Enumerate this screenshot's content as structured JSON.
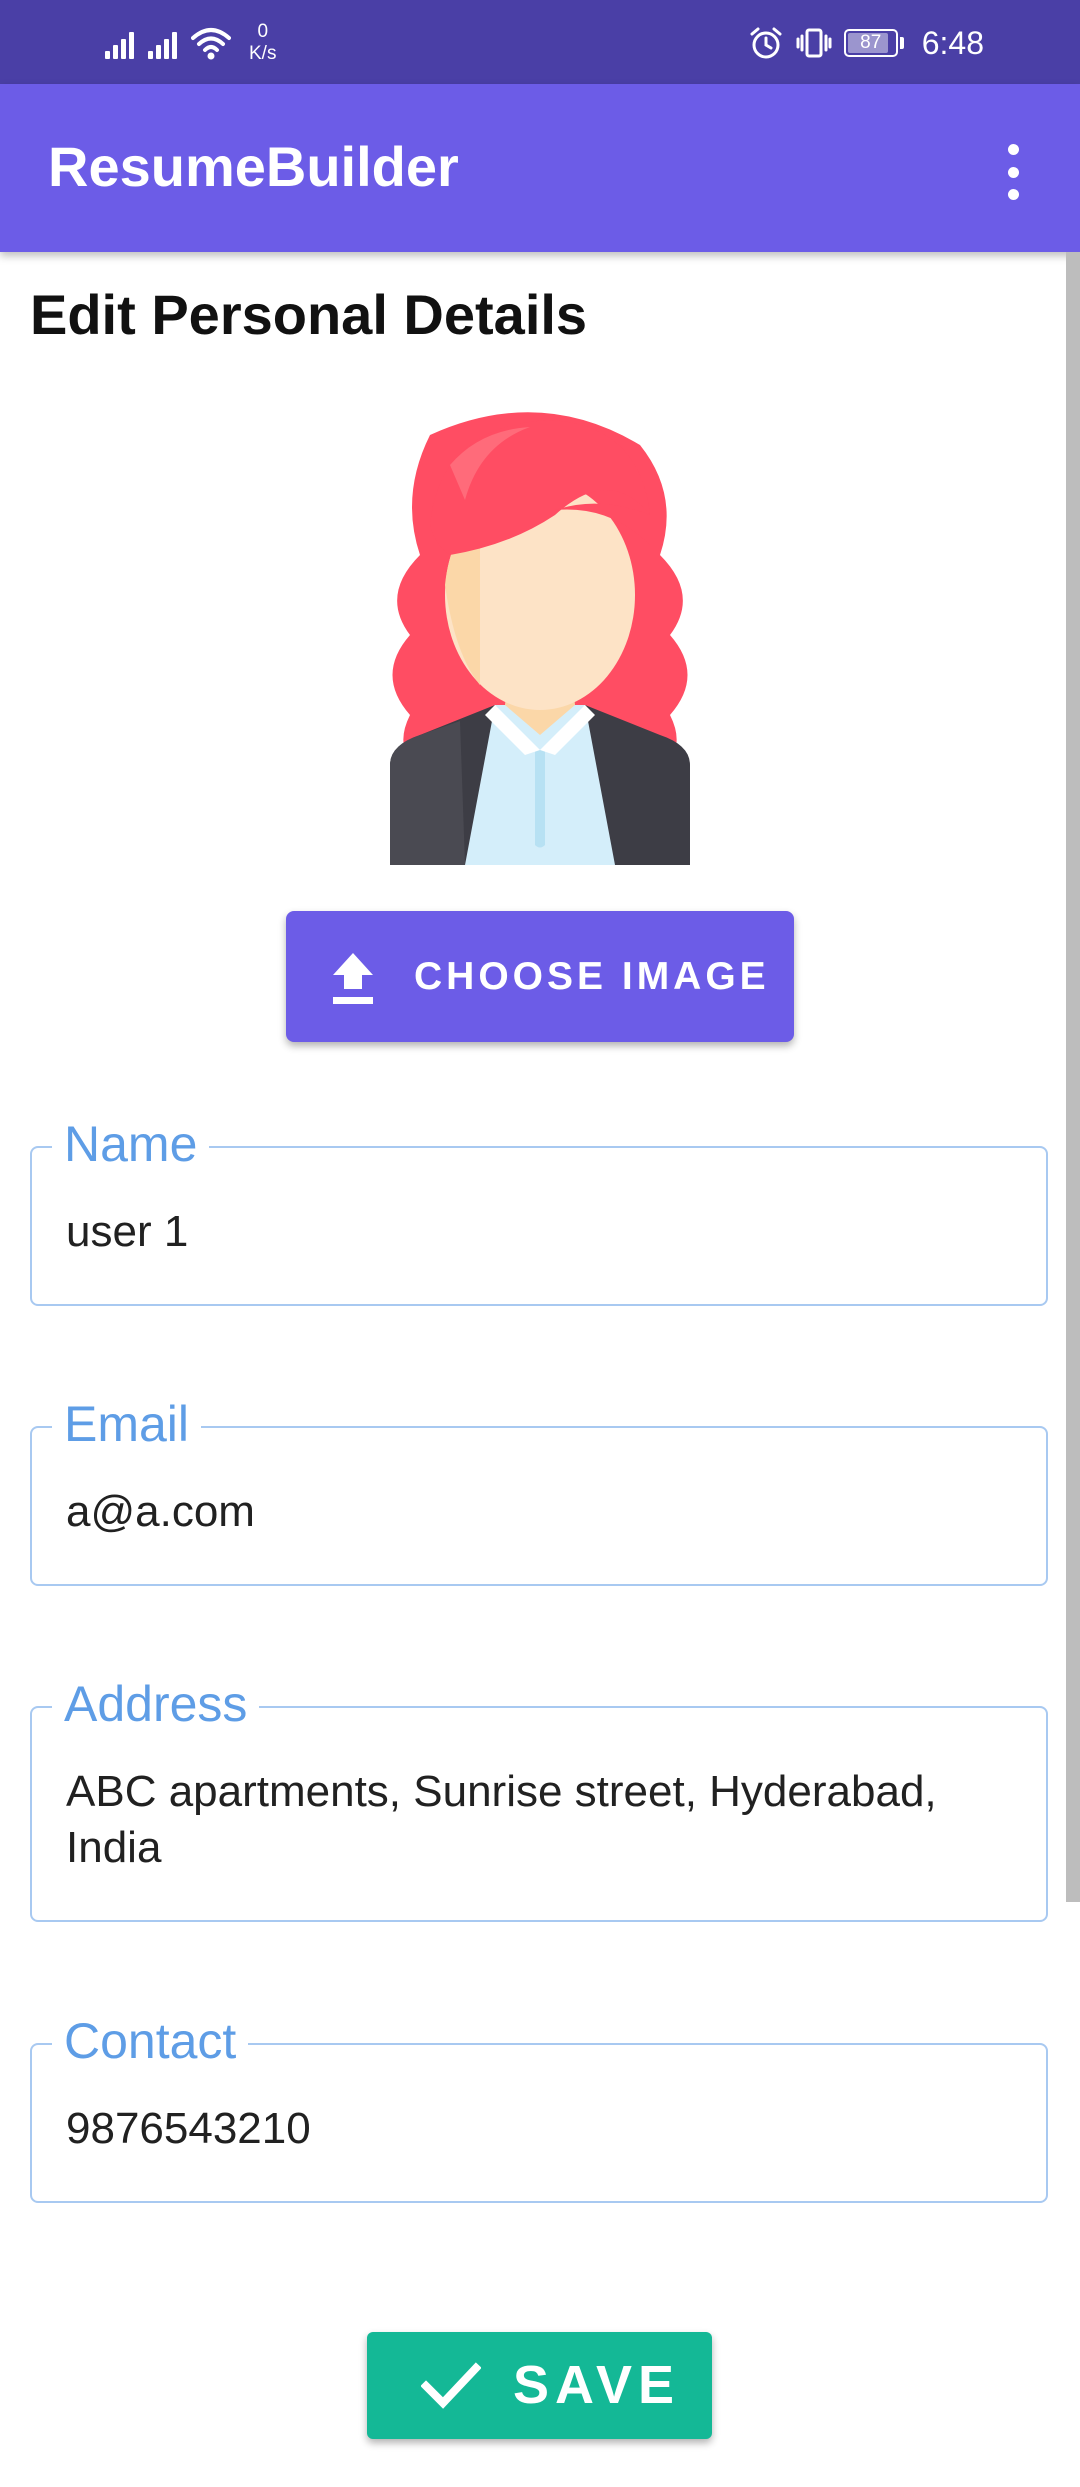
{
  "status_bar": {
    "speed_value": "0",
    "speed_unit": "K/s",
    "battery": "87",
    "time": "6:48",
    "background": "#4a3fa6"
  },
  "app_bar": {
    "title": "ResumeBuilder",
    "background": "#6c5ce7",
    "overflow_icon": "more-vert-icon"
  },
  "page": {
    "title": "Edit Personal Details"
  },
  "avatar": {
    "icon": "woman-avatar-icon"
  },
  "choose_image_button": {
    "label": "CHOOSE IMAGE",
    "icon": "upload-icon",
    "color": "#6c5ce7"
  },
  "form": {
    "fields": [
      {
        "label": "Name",
        "value": "user 1"
      },
      {
        "label": "Email",
        "value": "a@a.com"
      },
      {
        "label": "Address",
        "value": "ABC apartments, Sunrise street, Hyderabad, India"
      },
      {
        "label": "Contact",
        "value": "9876543210"
      }
    ],
    "label_color": "#5e9de6",
    "border_color": "#a8c9f1"
  },
  "save_button": {
    "label": "SAVE",
    "icon": "check-icon",
    "color": "#14b896"
  }
}
